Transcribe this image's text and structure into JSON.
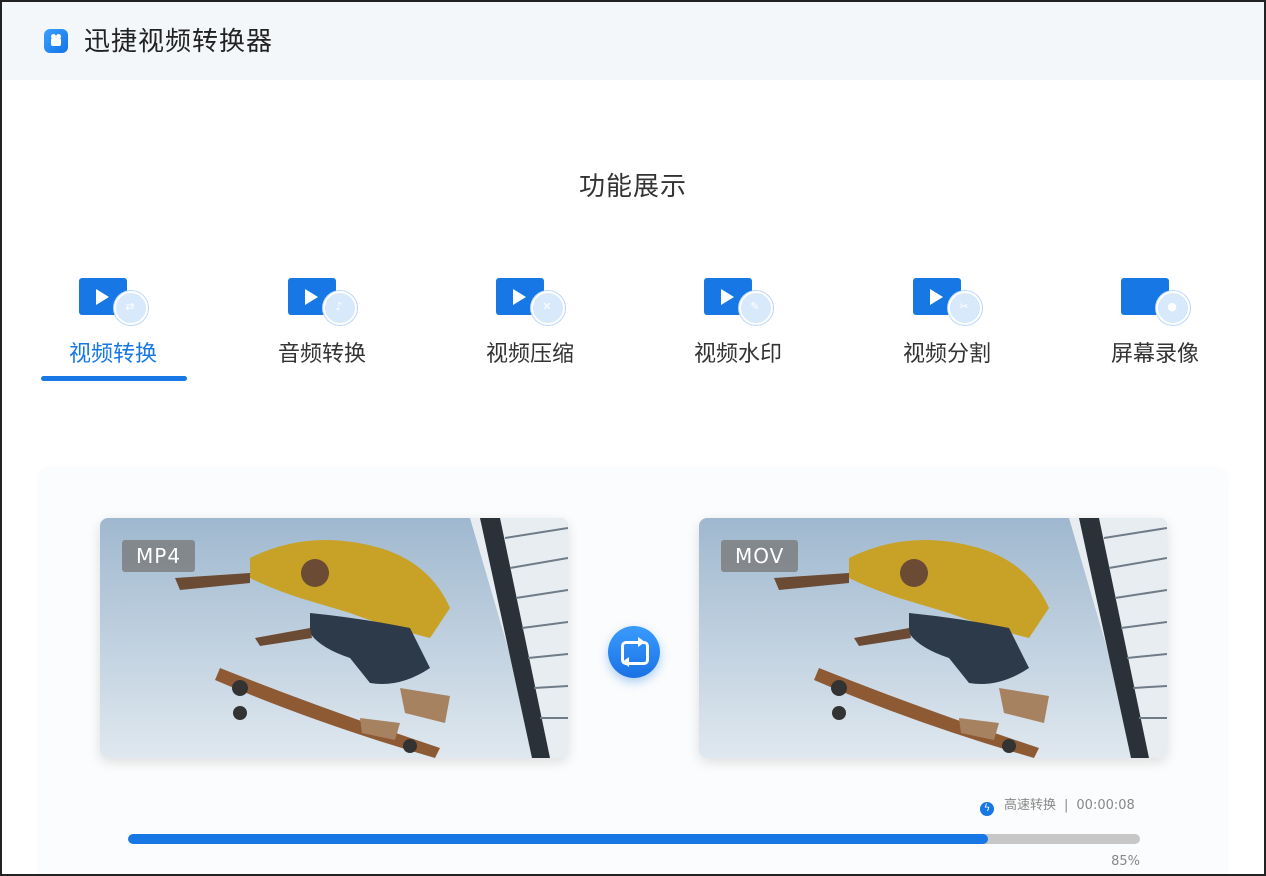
{
  "app": {
    "title": "迅捷视频转换器",
    "logo_icon": "camera-logo-icon"
  },
  "section": {
    "title": "功能展示"
  },
  "tabs": [
    {
      "label": "视频转换",
      "icon": "video-convert-icon",
      "active": true
    },
    {
      "label": "音频转换",
      "icon": "audio-convert-icon",
      "active": false
    },
    {
      "label": "视频压缩",
      "icon": "video-compress-icon",
      "active": false
    },
    {
      "label": "视频水印",
      "icon": "video-watermark-icon",
      "active": false
    },
    {
      "label": "视频分割",
      "icon": "video-split-icon",
      "active": false
    },
    {
      "label": "屏幕录像",
      "icon": "screen-record-icon",
      "active": false
    }
  ],
  "demo": {
    "source_format": "MP4",
    "target_format": "MOV",
    "convert_icon": "convert-loop-icon"
  },
  "status": {
    "mode": "高速转换",
    "separator": "|",
    "time": "00:00:08",
    "progress_fraction": 0.85,
    "progress_text": "85%"
  },
  "colors": {
    "accent": "#1677e5",
    "track": "#c7c7c7",
    "header_bg": "#f4f7fa"
  }
}
